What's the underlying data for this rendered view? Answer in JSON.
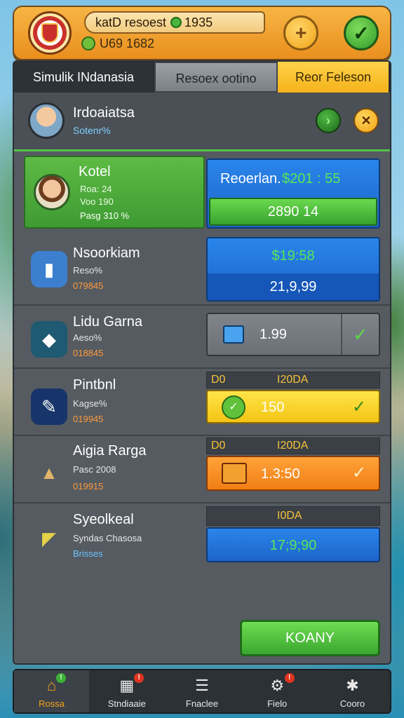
{
  "topbar": {
    "resource_line": "katD resoest",
    "resource_value": "1935",
    "sub_line": "U69 1682",
    "plus_label": "+",
    "check_label": "✓"
  },
  "tabs": [
    "Simulik INdanasia",
    "Resoex ootino",
    "Reor Feleson"
  ],
  "player": {
    "name": "Irdoaiatsa",
    "sub": "Sotenr%"
  },
  "rows": [
    {
      "title": "Kotel",
      "l1": "Roa: 24",
      "l2": "Voo 190",
      "l3": "Pasg 310 %",
      "box_label": "Reoerlan.",
      "box_value": "$201 : 55",
      "bar_value": "2890 14"
    },
    {
      "title": "Nsoorkiam",
      "l2": "Reso%",
      "l3": "079845",
      "box_value": "$19:58",
      "bar_value": "21,9,99"
    },
    {
      "title": "Lidu Garna",
      "l2": "Aeso%",
      "l3": "018845",
      "box_value": "1.99"
    },
    {
      "title": "Pintbnl",
      "l2": "Kagse%",
      "l3": "019945",
      "strip_left": "D0",
      "strip_right": "I20DA",
      "bar_value": "150"
    },
    {
      "title": "Aigia Rarga",
      "l2": "Pasc 2008",
      "l3": "019915",
      "strip_left": "D0",
      "strip_right": "I20DA",
      "bar_value": "1.3:50"
    },
    {
      "title": "Syeolkeal",
      "l2": "Syndas Chasosa",
      "l3": "Brisses",
      "strip_right": "I0DA",
      "bar_value": "17;9;90"
    }
  ],
  "ok_button": "KOANY",
  "nav": [
    {
      "label": "Rossa",
      "icon": "home-icon",
      "badge": "!"
    },
    {
      "label": "Stndiaaie",
      "icon": "shop-icon",
      "badge": "!"
    },
    {
      "label": "Fnaclee",
      "icon": "clipboard-icon",
      "badge": ""
    },
    {
      "label": "Fielo",
      "icon": "gear-icon",
      "badge": "!"
    },
    {
      "label": "Cooro",
      "icon": "wrench-icon",
      "badge": ""
    }
  ],
  "colors": {
    "accent_orange": "#f7b544",
    "accent_green": "#56c24a",
    "panel_grey": "#555b61",
    "bar_blue": "#1d64c9",
    "bar_yellow": "#f3c414",
    "bar_orange": "#f07e14"
  }
}
